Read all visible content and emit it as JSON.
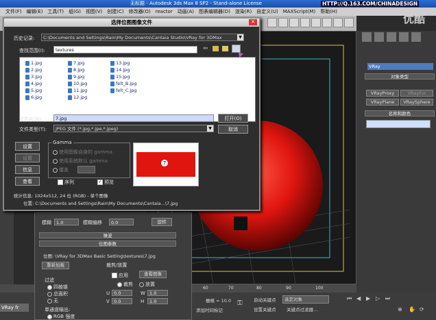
{
  "app": {
    "title": "无标题 - Autodesk 3ds Max 8 SP2 - Stand-alone License",
    "watermark_url": "HTTP://Q.163.COM/CHINADESIGN",
    "video_logo": "优酷"
  },
  "menu": [
    "文件(F)",
    "编辑(E)",
    "工具(T)",
    "组(G)",
    "视图(V)",
    "创建(C)",
    "修改器(O)",
    "reactor",
    "动画(A)",
    "图表编辑器(D)",
    "渲染(R)",
    "自定义(U)",
    "MAXScript(M)",
    "帮助(H)"
  ],
  "dialog": {
    "title": "选择位图图像文件",
    "history_label": "历史记录:",
    "history_value": "C:\\Documents and Settings\\Rain\\My Documents\\Cantaia Studio\\VRay for 3DMax",
    "lookin_label": "查找范围(I):",
    "lookin_value": "textures",
    "files": [
      "1.jpg",
      "2.jpg",
      "3.jpg",
      "4.jpg",
      "5.jpg",
      "6.jpg",
      "7.jpg",
      "8.jpg",
      "9.jpg",
      "10.jpg",
      "11.jpg",
      "12.jpg",
      "13.jpg",
      "14.jpg",
      "15.jpg",
      "felt_B.jpg",
      "felt_C.jpg"
    ],
    "filename_label": "文件名(N):",
    "filename_value": "7.jpg",
    "filetype_label": "文件类型(T):",
    "filetype_value": "JPEG 文件 (*.jpg,*.jpe,*.jpeg)",
    "open_button": "打开(O)",
    "cancel_button": "取消",
    "setup_button": "设置",
    "info_button": "信息",
    "view_button": "查看",
    "settings_button": "设置",
    "gamma_title": "Gamma",
    "gamma_options": [
      "使用图像自身的 gamma",
      "使用系统默认 gamma",
      "覆盖"
    ],
    "sequence_label": "序列",
    "preview_label": "预览",
    "stats_line": "统计信息: 1024x512, 24 位 (RGB) - 单个图像",
    "location_line": "位置: C:\\Documents and Settings\\Rain\\My Documents\\Cantaia...\\7.jpg"
  },
  "material_panel": {
    "blur_label": "模糊",
    "blur_value": "1.0",
    "blur_offset_label": "模糊偏移",
    "blur_offset_value": "0.0",
    "rotate_button": "旋转",
    "noise_rollout": "噪波",
    "bitmap_rollout": "位图参数",
    "bitmap_path": "位图: \\VRay for 3DMax Basic Setting\\textures\\7.jpg",
    "reload_button": "重新加载",
    "crop_label": "裁剪/放置",
    "apply_label": "应用",
    "view_image_button": "查看图像",
    "crop_option": "裁剪",
    "place_option": "放置",
    "u_value": "0.0",
    "v_value": "0.0",
    "w_value": "1.0",
    "h_value": "1.0",
    "filter_label": "过滤",
    "filter_options": [
      "四棱锥",
      "总面积",
      "无"
    ],
    "mono_label": "单通道输出:",
    "mono_value": "RGB 强度"
  },
  "command_panel": {
    "dropdown": "VRay",
    "object_type": "对象类型",
    "buttons": [
      "VRayProxy",
      "VRayFur",
      "VRayPlane",
      "VRaySphere"
    ],
    "name_color": "名称和颜色"
  },
  "timeline": {
    "ticks": [
      "60",
      "70",
      "80",
      "90",
      "100"
    ]
  },
  "status": {
    "auto_key": "自动关键点",
    "set_key": "设置关键点",
    "selected": "选定对象",
    "key_filter": "关键点过滤器...",
    "grid": "栅格 = 10.0",
    "add_time_tag": "添加时间标记",
    "vray_tab": "VRay fr"
  },
  "colors": {
    "sphere_red": "#e0150f",
    "titlebar_blue": "#2a6fd6"
  }
}
